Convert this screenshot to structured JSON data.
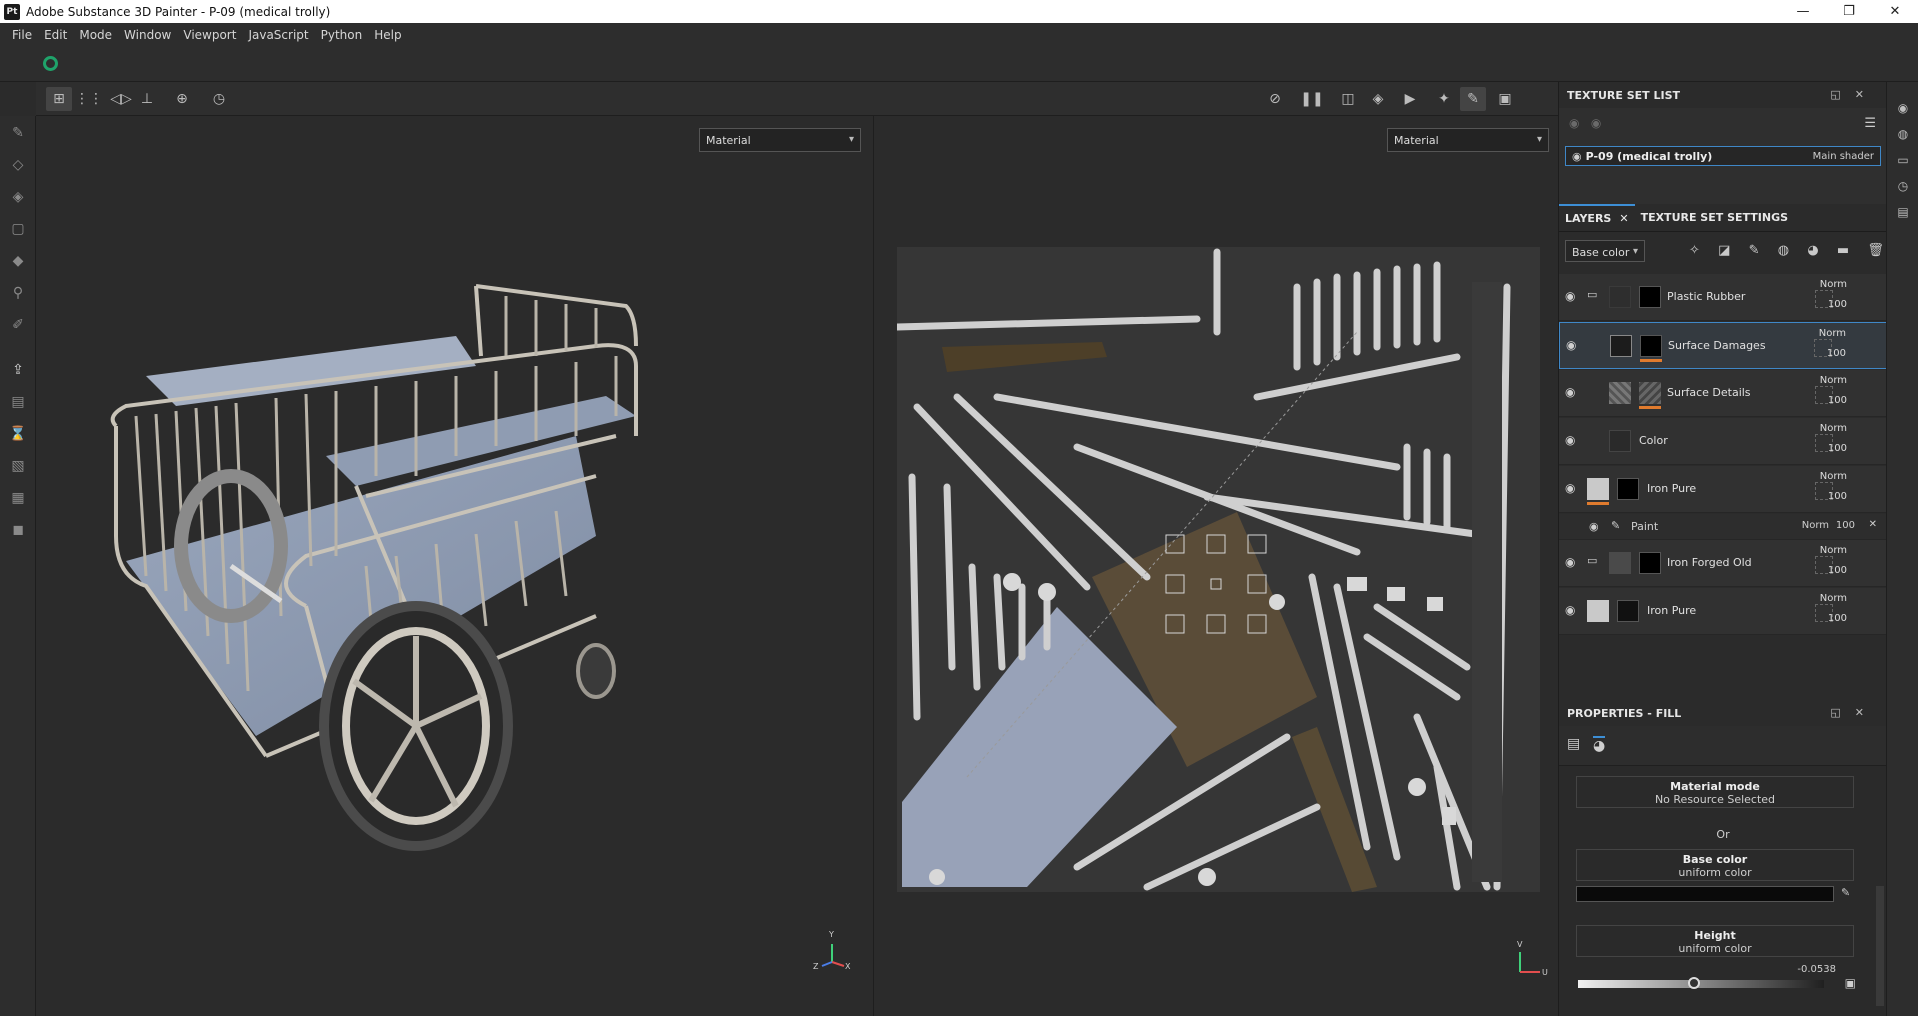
{
  "window": {
    "app_icon": "Pt",
    "title": "Adobe Substance 3D Painter - P-09 (medical trolly)",
    "controls": [
      "minimize-icon",
      "restore-icon",
      "close-icon"
    ]
  },
  "menu": [
    "File",
    "Edit",
    "Mode",
    "Window",
    "Viewport",
    "JavaScript",
    "Python",
    "Help"
  ],
  "viewport_3d": {
    "mode": "Material",
    "axis_labels": [
      "Y",
      "Z",
      "X"
    ]
  },
  "viewport_2d": {
    "mode": "Material",
    "axis_labels": [
      "V",
      "U"
    ]
  },
  "texture_set_list": {
    "title": "TEXTURE SET LIST",
    "items": [
      {
        "name": "P-09 (medical trolly)",
        "shader": "Main shader"
      }
    ]
  },
  "layers_panel": {
    "tabs": [
      "LAYERS",
      "TEXTURE SET SETTINGS"
    ],
    "channel": "Base color",
    "layers": [
      {
        "name": "Plastic Rubber",
        "blend": "Norm",
        "opacity": "100",
        "type": "folder"
      },
      {
        "name": "Surface Damages",
        "blend": "Norm",
        "opacity": "100",
        "type": "fill",
        "selected": true
      },
      {
        "name": "Surface Details",
        "blend": "Norm",
        "opacity": "100",
        "type": "fill"
      },
      {
        "name": "Color",
        "blend": "Norm",
        "opacity": "100",
        "type": "fill"
      },
      {
        "name": "Iron Pure",
        "blend": "Norm",
        "opacity": "100",
        "type": "fill"
      },
      {
        "name": "Iron Forged Old",
        "blend": "Norm",
        "opacity": "100",
        "type": "folder"
      },
      {
        "name": "Iron Pure",
        "blend": "Norm",
        "opacity": "100",
        "type": "fill"
      }
    ],
    "sublayer": {
      "name": "Paint",
      "blend": "Norm",
      "opacity": "100"
    }
  },
  "properties": {
    "title": "PROPERTIES - FILL",
    "material_mode": {
      "label": "Material mode",
      "value": "No Resource Selected"
    },
    "or_text": "Or",
    "base_color": {
      "label": "Base color",
      "value": "uniform color",
      "color": "#0a0a0a"
    },
    "height": {
      "label": "Height",
      "value": "uniform color",
      "number": "-0.0538",
      "slider": 0.47
    }
  },
  "colors": {
    "accent": "#3f87c7",
    "orange": "#e07b2e"
  }
}
